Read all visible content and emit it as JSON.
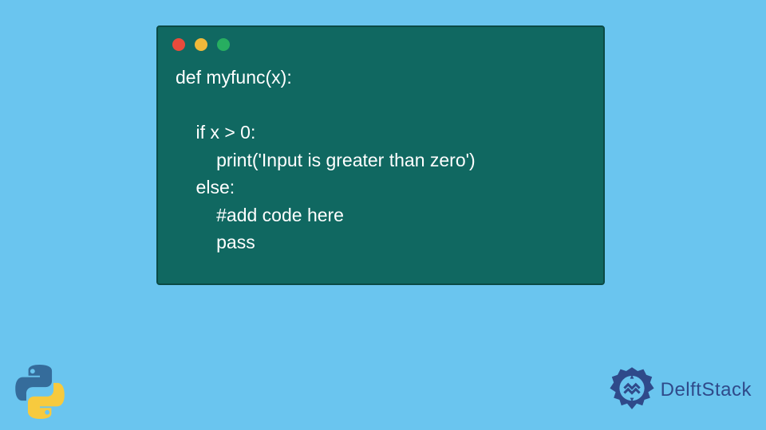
{
  "code": {
    "lines": [
      "def myfunc(x):",
      "",
      "    if x > 0:",
      "        print('Input is greater than zero')",
      "    else:",
      "        #add code here",
      "        pass"
    ]
  },
  "traffic_lights": {
    "red": "#e84b3c",
    "yellow": "#f0b93a",
    "green": "#27ae60"
  },
  "logos": {
    "python": "python-logo",
    "delftstack_text": "DelftStack"
  },
  "colors": {
    "background": "#6ac5ef",
    "window_bg": "#106861",
    "window_border": "#0b4a45",
    "code_text": "#ffffff",
    "delft_brand": "#2f4a8a"
  }
}
